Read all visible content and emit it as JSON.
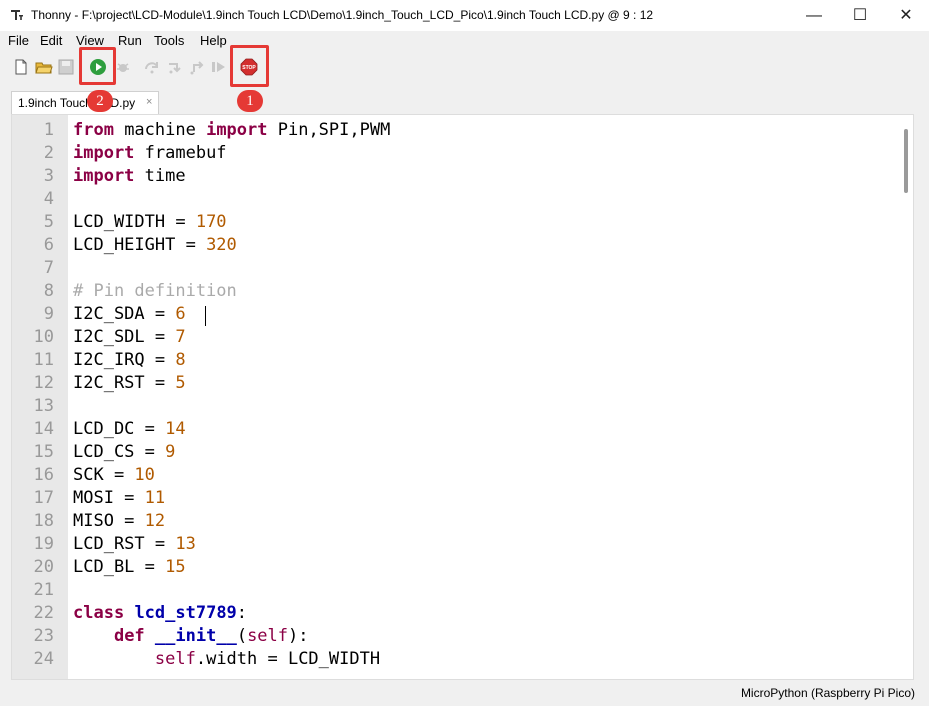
{
  "window": {
    "title": "Thonny  -  F:\\project\\LCD-Module\\1.9inch Touch LCD\\Demo\\1.9inch_Touch_LCD_Pico\\1.9inch Touch LCD.py  @  9 : 12",
    "minimize": "—",
    "maximize": "☐",
    "close": "✕"
  },
  "menu": [
    "File",
    "Edit",
    "View",
    "Run",
    "Tools",
    "Help"
  ],
  "toolbar": {
    "icons": [
      "new-file-icon",
      "open-file-icon",
      "save-icon",
      "run-icon",
      "debug-icon",
      "step-over-icon",
      "step-into-icon",
      "step-out-icon",
      "resume-icon",
      "stop-icon"
    ],
    "stop_label": "STOP"
  },
  "tab": {
    "label": "1.9inch Touch LCD.py",
    "close": "×"
  },
  "editor": {
    "line_numbers": [
      "1",
      "2",
      "3",
      "4",
      "5",
      "6",
      "7",
      "8",
      "9",
      "10",
      "11",
      "12",
      "13",
      "14",
      "15",
      "16",
      "17",
      "18",
      "19",
      "20",
      "21",
      "22",
      "23",
      "24"
    ],
    "code": [
      "from machine import Pin,SPI,PWM",
      "import framebuf",
      "import time",
      "",
      "LCD_WIDTH = 170",
      "LCD_HEIGHT = 320",
      "",
      "# Pin definition",
      "I2C_SDA = 6",
      "I2C_SDL = 7",
      "I2C_IRQ = 8",
      "I2C_RST = 5",
      "",
      "LCD_DC = 14",
      "LCD_CS = 9",
      "SCK = 10",
      "MOSI = 11",
      "MISO = 12",
      "LCD_RST = 13",
      "LCD_BL = 15",
      "",
      "class lcd_st7789:",
      "    def __init__(self):",
      "        self.width = LCD_WIDTH"
    ]
  },
  "status": {
    "interpreter": "MicroPython (Raspberry Pi Pico)"
  },
  "annotations": {
    "badge_1": "1",
    "badge_2": "2",
    "color": "#e53935"
  }
}
